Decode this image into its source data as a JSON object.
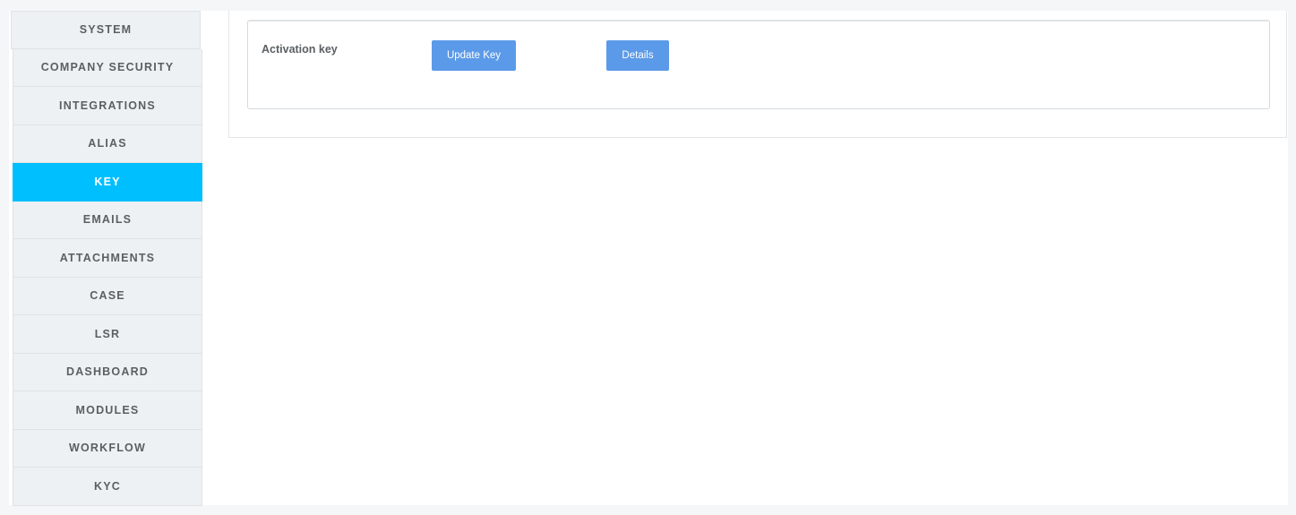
{
  "sidebar": {
    "items": [
      {
        "label": "SYSTEM",
        "active": false
      },
      {
        "label": "COMPANY SECURITY",
        "active": false
      },
      {
        "label": "INTEGRATIONS",
        "active": false
      },
      {
        "label": "ALIAS",
        "active": false
      },
      {
        "label": "KEY",
        "active": true
      },
      {
        "label": "EMAILS",
        "active": false
      },
      {
        "label": "ATTACHMENTS",
        "active": false
      },
      {
        "label": "CASE",
        "active": false
      },
      {
        "label": "LSR",
        "active": false
      },
      {
        "label": "DASHBOARD",
        "active": false
      },
      {
        "label": "MODULES",
        "active": false
      },
      {
        "label": "WORKFLOW",
        "active": false
      },
      {
        "label": "KYC",
        "active": false
      }
    ]
  },
  "main": {
    "activation_label": "Activation key",
    "update_button": "Update Key",
    "details_button": "Details"
  },
  "colors": {
    "accent": "#00bfff",
    "button": "#5b9ae8",
    "sidebar_bg": "#eef1f3"
  }
}
